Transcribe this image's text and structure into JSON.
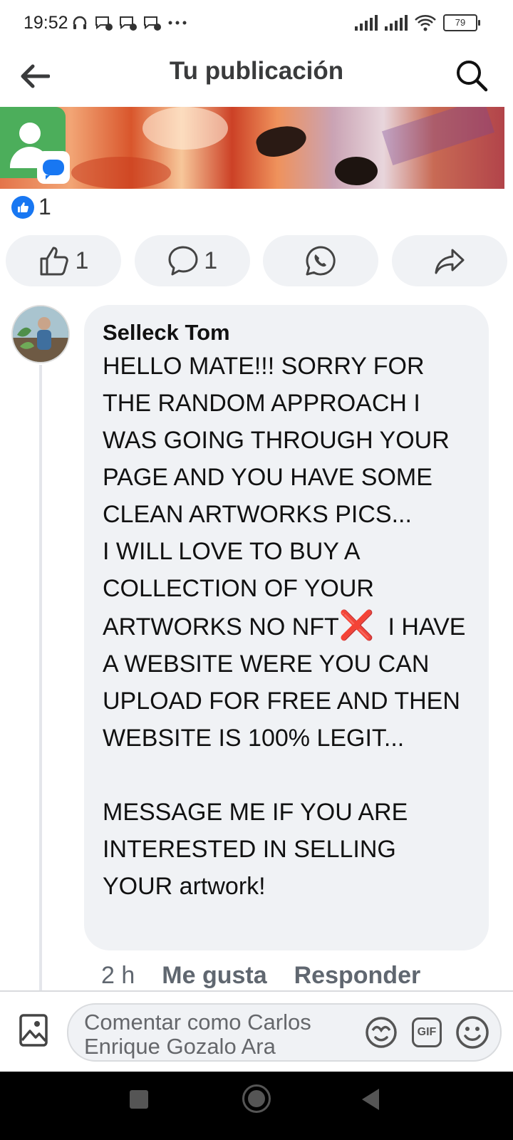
{
  "status_bar": {
    "time": "19:52",
    "battery": "79"
  },
  "header": {
    "title": "Tu publicación"
  },
  "reactions": {
    "like_count": "1"
  },
  "actions": {
    "like_count": "1",
    "comment_count": "1"
  },
  "comment": {
    "author": "Selleck Tom",
    "text_part1": "HELLO MATE!!! SORRY FOR THE RANDOM APPROACH I WAS GOING THROUGH YOUR PAGE AND YOU HAVE SOME CLEAN ARTWORKS PICS...\nI WILL LOVE TO BUY A COLLECTION OF YOUR ARTWORKS NO NFT",
    "text_part2": "  I HAVE A WEBSITE WERE YOU CAN UPLOAD FOR FREE AND THEN WEBSITE IS 100% LEGIT...\n\nMESSAGE ME IF YOU ARE INTERESTED IN SELLING YOUR artwork!",
    "emoji": "❌",
    "time": "2 h",
    "like_label": "Me gusta",
    "reply_label": "Responder"
  },
  "composer": {
    "placeholder": "Comentar como Carlos Enrique Gozalo Ara",
    "gif_label": "GIF"
  },
  "colors": {
    "facebook_blue": "#1877f2",
    "bubble_bg": "#f0f2f5",
    "nav_bg": "#000000"
  }
}
